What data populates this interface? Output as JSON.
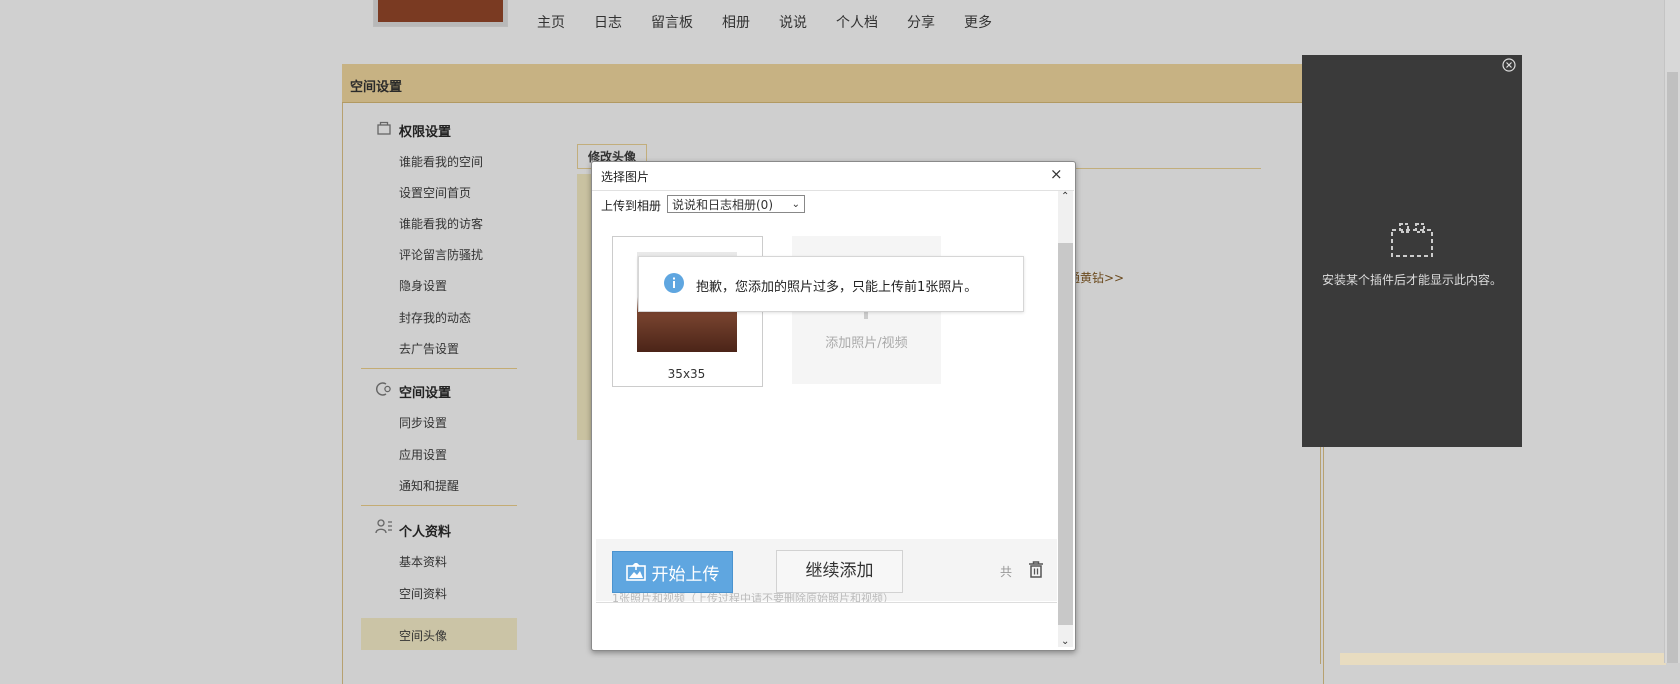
{
  "topnav": {
    "items": [
      "主页",
      "日志",
      "留言板",
      "相册",
      "说说",
      "个人档",
      "分享",
      "更多"
    ]
  },
  "panel": {
    "title": "空间设置"
  },
  "sidebar": {
    "groups": [
      {
        "title": "权限设置",
        "icon": "lock-icon",
        "items": [
          "谁能看我的空间",
          "设置空间首页",
          "谁能看我的访客",
          "评论留言防骚扰",
          "隐身设置",
          "封存我的动态",
          "去广告设置"
        ]
      },
      {
        "title": "空间设置",
        "icon": "settings-icon",
        "items": [
          "同步设置",
          "应用设置",
          "通知和提醒"
        ]
      },
      {
        "title": "个人资料",
        "icon": "profile-icon",
        "items": [
          "基本资料",
          "空间资料",
          "空间头像"
        ]
      }
    ],
    "active_item": "空间头像"
  },
  "content": {
    "tab_label": "修改头像",
    "diamond_link": "通黄钻>>"
  },
  "plugin": {
    "message": "安装某个插件后才能显示此内容。"
  },
  "dialog": {
    "title": "选择图片",
    "close_label": "×",
    "upload_to_label": "上传到相册",
    "album_select_value": "说说和日志相册(0)",
    "thumbnail_label": "35x35",
    "add_label": "添加照片/视频",
    "toast_text": "抱歉，您添加的照片过多，只能上传前1张照片。",
    "start_upload_label": "开始上传",
    "continue_add_label": "继续添加",
    "total_label": "共",
    "hint_text": "1张照片和视频（上传过程中请不要删除原始照片和视频）"
  },
  "colors": {
    "panel_header": "#c7b283",
    "primary_button": "#5fa6e0",
    "plugin_bg": "#3a3a3a",
    "info_icon": "#5fa6e0"
  }
}
